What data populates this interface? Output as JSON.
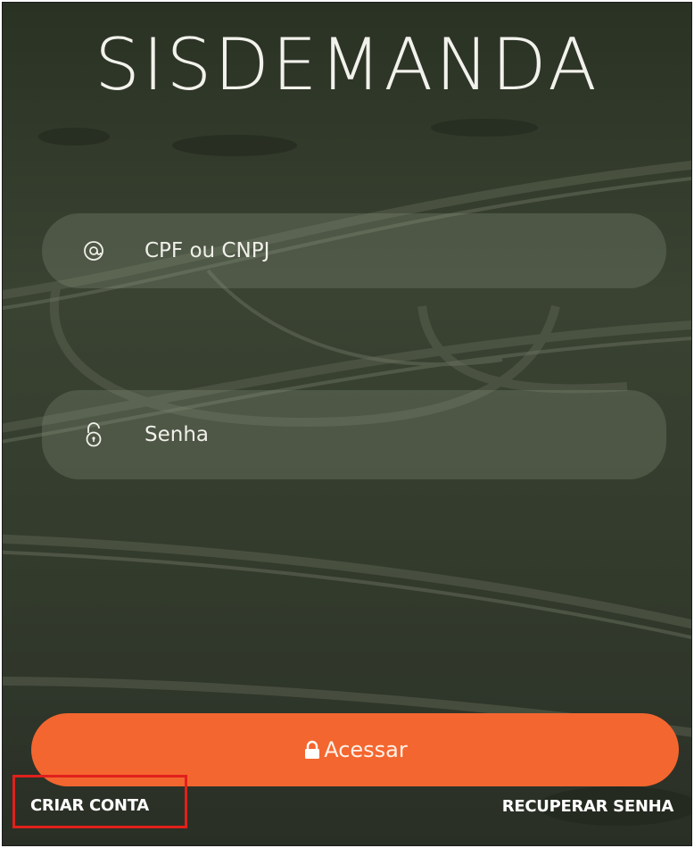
{
  "app": {
    "title": "SISDEMANDA"
  },
  "login_form": {
    "username_placeholder": "CPF ou CNPJ",
    "password_placeholder": "Senha",
    "submit_label": "Acessar"
  },
  "links": {
    "create_account": "CRIAR CONTA",
    "recover_password": "RECUPERAR SENHA"
  },
  "colors": {
    "button": "#f4662f",
    "highlight": "#e0201c",
    "background": "#2c3326"
  },
  "icons": {
    "username": "at-sign-icon",
    "password": "open-lock-icon",
    "submit": "lock-icon"
  }
}
